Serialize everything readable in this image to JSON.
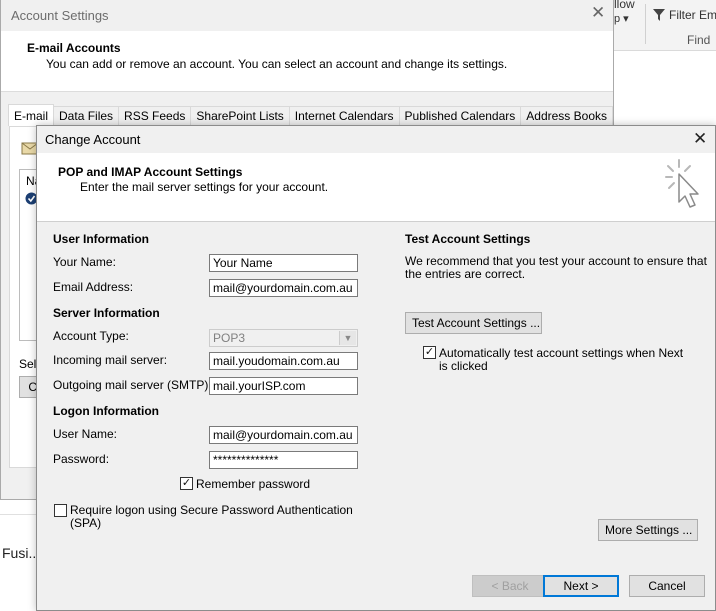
{
  "background": {
    "ribbon_follow": "llow",
    "ribbon_up": "p ▾",
    "filter_email": "Filter Em",
    "find_group": "Find",
    "fusi_label": "Fusi..."
  },
  "account_settings": {
    "title": "Account Settings",
    "header_title": "E-mail Accounts",
    "header_desc": "You can add or remove an account. You can select an account and change its settings.",
    "tabs": [
      "E-mail",
      "Data Files",
      "RSS Feeds",
      "SharePoint Lists",
      "Internet Calendars",
      "Published Calendars",
      "Address Books"
    ],
    "partial_name": "Na",
    "partial_select": "Sele",
    "partial_button": "Cl"
  },
  "change_account": {
    "title": "Change Account",
    "header_title": "POP and IMAP Account Settings",
    "header_desc": "Enter the mail server settings for your account.",
    "user_info": {
      "heading": "User Information",
      "name_label": "Your Name:",
      "name_value": "Your Name",
      "email_label": "Email Address:",
      "email_value": "mail@yourdomain.com.au"
    },
    "server_info": {
      "heading": "Server Information",
      "account_type_label": "Account Type:",
      "account_type_value": "POP3",
      "incoming_label": "Incoming mail server:",
      "incoming_value": "mail.youdomain.com.au",
      "outgoing_label": "Outgoing mail server (SMTP):",
      "outgoing_value": "mail.yourISP.com"
    },
    "logon_info": {
      "heading": "Logon Information",
      "username_label": "User Name:",
      "username_value": "mail@yourdomain.com.au",
      "password_label": "Password:",
      "password_value": "**************",
      "remember_label": "Remember password",
      "remember_checked": true,
      "spa_label_1": "Require logon using Secure Password Authentication",
      "spa_label_2": "(SPA)",
      "spa_checked": false
    },
    "test_settings": {
      "heading": "Test Account Settings",
      "desc_1": "We recommend that you test your account to ensure that",
      "desc_2": "the entries are correct.",
      "test_button": "Test Account Settings ...",
      "auto_test_label_1": "Automatically test account settings when Next",
      "auto_test_label_2": "is clicked",
      "auto_test_checked": true
    },
    "more_settings_button": "More Settings ...",
    "back_button": "< Back",
    "next_button": "Next >",
    "cancel_button": "Cancel"
  },
  "colors": {
    "accent": "#0078d7",
    "dialog_bg": "#f0f0f0",
    "header_bg": "#ffffff"
  }
}
